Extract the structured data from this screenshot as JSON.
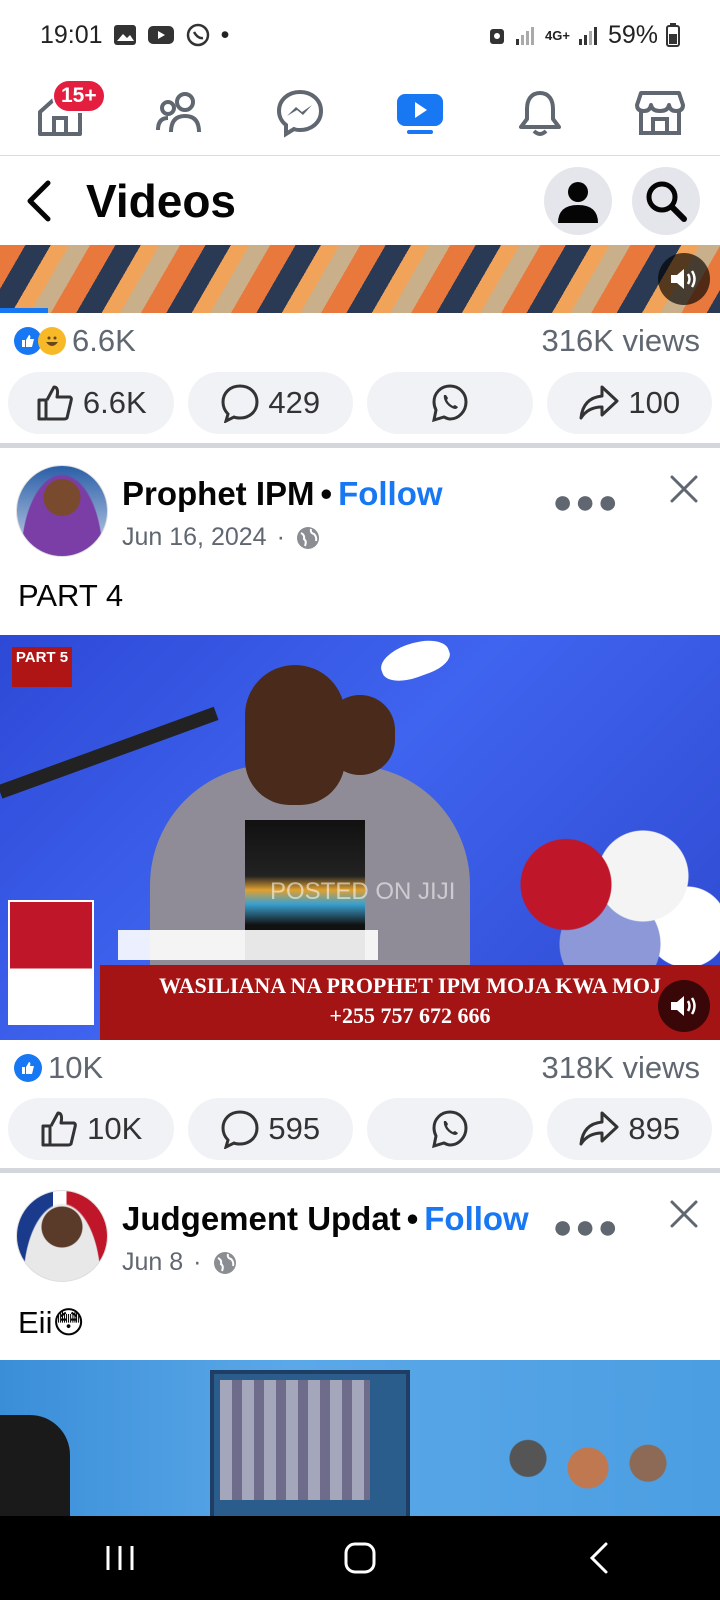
{
  "status_bar": {
    "time": "19:01",
    "dot": "•",
    "battery": "59%",
    "network": "4G+"
  },
  "tab_bar": {
    "home_badge": "15+",
    "tabs": [
      "home-icon",
      "friends-icon",
      "messenger-icon",
      "video-icon",
      "bell-icon",
      "marketplace-icon"
    ],
    "active_color": "#1877f2"
  },
  "header": {
    "title": "Videos"
  },
  "post0": {
    "reactions": "6.6K",
    "views": "316K views",
    "like_count": "6.6K",
    "comment_count": "429",
    "share_count": "100"
  },
  "post1": {
    "author": "Prophet IPM",
    "separator": "•",
    "follow": "Follow",
    "date": "Jun 16, 2024",
    "date_sep": "·",
    "caption": "PART 4",
    "thumb_badge": "PART 5",
    "thumb_banner": "WASILIANA NA PROPHET IPM MOJA KWA MOJ",
    "thumb_phone": "+255 757 672 666",
    "thumb_watermark": "POSTED ON JIJI",
    "reactions": "10K",
    "views": "318K views",
    "like_count": "10K",
    "comment_count": "595",
    "share_count": "895"
  },
  "post2": {
    "author": "Judgement Updat",
    "separator": "•",
    "follow": "Follow",
    "date": "Jun 8",
    "date_sep": "·",
    "caption": "Eii😳"
  }
}
